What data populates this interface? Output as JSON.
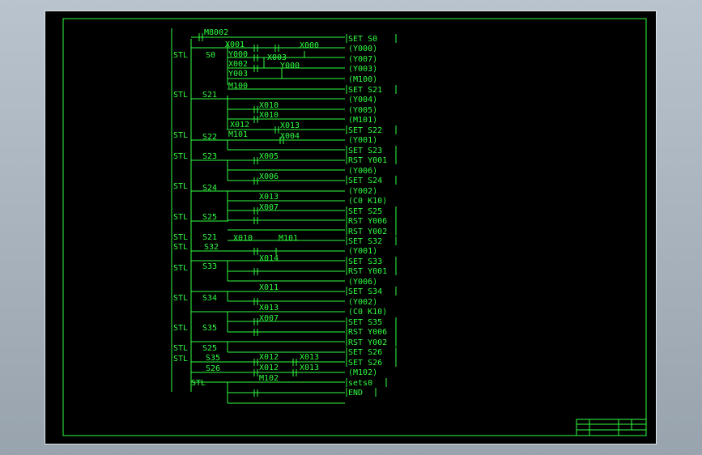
{
  "diagram": {
    "colors": {
      "background": "#000000",
      "wire": "#2fff3f",
      "sheet_border": "#dfe6ea",
      "desktop": "#a7b1bb"
    },
    "rows": [
      {
        "labels": [
          "M8002"
        ],
        "outputs": [
          "SET S0"
        ]
      },
      {
        "labels": [
          "STL",
          "S0",
          "X001",
          "X000"
        ],
        "outputs": [
          "(Y000)"
        ]
      },
      {
        "labels": [
          "Y000",
          "X003"
        ],
        "outputs": [
          "(Y007)"
        ]
      },
      {
        "labels": [
          "X002",
          "Y000"
        ],
        "outputs": [
          "(Y003)"
        ]
      },
      {
        "labels": [
          "Y003"
        ],
        "outputs": [
          "(M100)"
        ]
      },
      {
        "labels": [
          "M100"
        ],
        "outputs": [
          "SET S21"
        ]
      },
      {
        "labels": [
          "STL",
          "S21"
        ],
        "outputs": [
          "(Y004)"
        ]
      },
      {
        "labels": [
          "X010"
        ],
        "outputs": [
          "(Y005)"
        ]
      },
      {
        "labels": [
          "X010"
        ],
        "outputs": [
          "(M101)"
        ]
      },
      {
        "labels": [
          "X012",
          "X013"
        ],
        "outputs": [
          "SET S22"
        ]
      },
      {
        "labels": [
          "STL",
          "S22",
          "M101",
          "X004"
        ],
        "outputs": [
          "(Y001)"
        ]
      },
      {
        "labels": [
          "STL",
          "S23",
          "X005"
        ],
        "outputs": [
          "SET S23",
          "RST Y001"
        ]
      },
      {
        "labels": [
          "X006"
        ],
        "outputs": [
          "(Y006)",
          "SET S24"
        ]
      },
      {
        "labels": [
          "STL",
          "S24"
        ],
        "outputs": [
          "(Y002)"
        ]
      },
      {
        "labels": [
          "X013"
        ],
        "outputs": [
          "(C0 K10)"
        ]
      },
      {
        "labels": [
          "X007"
        ],
        "outputs": [
          "SET S25"
        ]
      },
      {
        "labels": [
          "STL",
          "S25"
        ],
        "outputs": [
          "RST Y006",
          "RST Y002"
        ]
      },
      {
        "labels": [
          "STL",
          "S21",
          "X010",
          "M101"
        ],
        "outputs": [
          "SET S32"
        ]
      },
      {
        "labels": [
          "STL",
          "S32"
        ],
        "outputs": [
          "(Y001)"
        ]
      },
      {
        "labels": [
          "X014"
        ],
        "outputs": [
          "SET S33",
          "RST Y001"
        ]
      },
      {
        "labels": [
          "STL",
          "S33"
        ],
        "outputs": [
          "(Y006)"
        ]
      },
      {
        "labels": [
          "X011"
        ],
        "outputs": [
          "SET S34"
        ]
      },
      {
        "labels": [
          "STL",
          "S34"
        ],
        "outputs": [
          "(Y002)"
        ]
      },
      {
        "labels": [
          "X013"
        ],
        "outputs": [
          "(C0 K10)"
        ]
      },
      {
        "labels": [
          "X007"
        ],
        "outputs": [
          "SET S35"
        ]
      },
      {
        "labels": [
          "STL",
          "S35"
        ],
        "outputs": [
          "RST Y006",
          "RST Y002"
        ]
      },
      {
        "labels": [
          "STL",
          "S25",
          "X012",
          "X013"
        ],
        "outputs": [
          "SET S26"
        ]
      },
      {
        "labels": [
          "STL",
          "S35",
          "X012",
          "X013"
        ],
        "outputs": [
          "SET S26"
        ]
      },
      {
        "labels": [
          "S26"
        ],
        "outputs": [
          "(M102)"
        ]
      },
      {
        "labels": [
          "STL",
          "M102"
        ],
        "outputs": [
          "sets0"
        ]
      },
      {
        "labels": [],
        "outputs": [
          "END"
        ]
      }
    ]
  }
}
